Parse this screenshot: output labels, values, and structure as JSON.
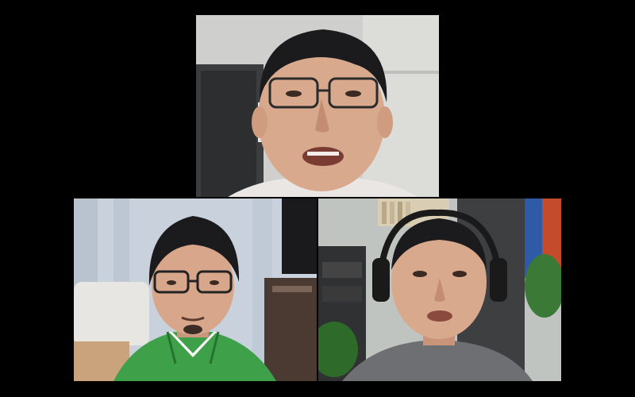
{
  "call": {
    "participant_count": 3,
    "layout": "gallery"
  },
  "participants": [
    {
      "position": "top",
      "video_on": true,
      "description_icon": "participant-video"
    },
    {
      "position": "bottom-left",
      "video_on": true,
      "description_icon": "participant-video"
    },
    {
      "position": "bottom-right",
      "video_on": true,
      "description_icon": "participant-video"
    }
  ],
  "colors": {
    "background": "#000000",
    "shirt_green": "#3fa04a",
    "shirt_gray": "#6d6f72",
    "skin": "#d9a98e",
    "hair": "#1b1b1d"
  }
}
